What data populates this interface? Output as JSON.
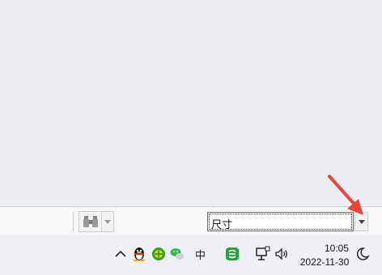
{
  "status_bar": {
    "find_button": {
      "icon": "binoculars-icon"
    },
    "size_selector": {
      "value": "尺寸"
    }
  },
  "annotation": {
    "color": "#e8453c"
  },
  "taskbar": {
    "tray_icons": [
      "chevron-up-icon",
      "qq-penguin-icon",
      "green-plus-icon",
      "wechat-icon",
      "ime-chinese-indicator",
      "wps-icon",
      "network-icon",
      "volume-icon"
    ],
    "ime_label": "中",
    "clock": {
      "time": "10:05",
      "date": "2022-11-30"
    },
    "notification_icon": "moon-icon"
  }
}
